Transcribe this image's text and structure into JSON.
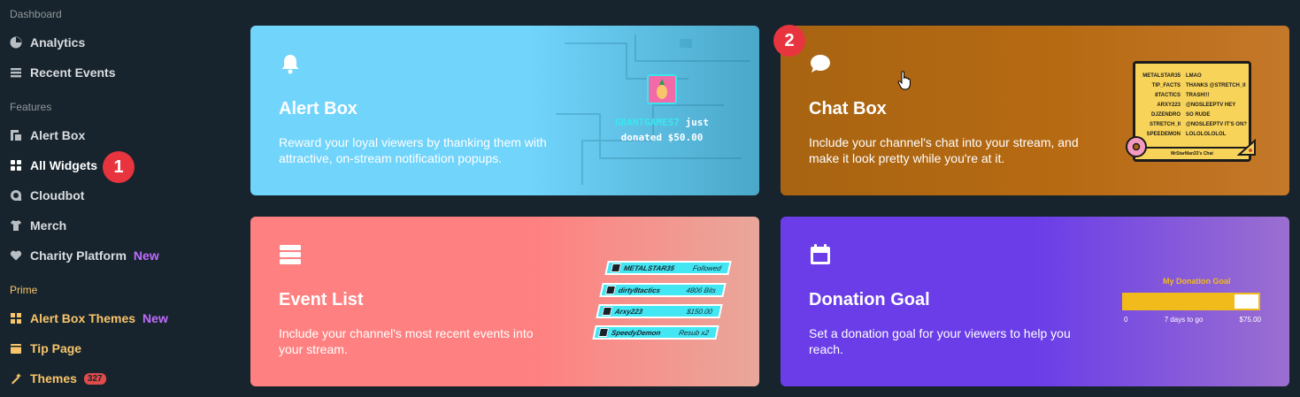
{
  "sidebar": {
    "sections": [
      {
        "label": "Dashboard"
      },
      {
        "label": "Features"
      },
      {
        "label": "Prime"
      }
    ],
    "items": [
      {
        "label": "Analytics",
        "icon": "analytics-icon"
      },
      {
        "label": "Recent Events",
        "icon": "list-icon"
      },
      {
        "label": "Alert Box",
        "icon": "alert-box-icon"
      },
      {
        "label": "All Widgets",
        "icon": "grid-icon"
      },
      {
        "label": "Cloudbot",
        "icon": "cloudbot-icon"
      },
      {
        "label": "Merch",
        "icon": "shirt-icon"
      },
      {
        "label": "Charity Platform",
        "icon": "heart-icon",
        "tag": "New"
      },
      {
        "label": "Alert Box Themes",
        "icon": "themes-grid-icon",
        "tag": "New"
      },
      {
        "label": "Tip Page",
        "icon": "tip-page-icon"
      },
      {
        "label": "Themes",
        "icon": "wand-icon",
        "count": "327"
      }
    ]
  },
  "badges": {
    "step1": "1",
    "step2": "2"
  },
  "cards": {
    "alert_box": {
      "title": "Alert Box",
      "desc": "Reward your loyal viewers by thanking them with attractive, on-stream notification popups.",
      "preview": {
        "name": "GRANTGAME57",
        "line1_suffix": " just",
        "line2": "donated $50.00"
      }
    },
    "chat_box": {
      "title": "Chat Box",
      "desc": "Include your channel's chat into your stream, and make it look pretty while you're at it.",
      "preview": {
        "rows": [
          {
            "user": "METALSTAR35",
            "msg": "LMAO"
          },
          {
            "user": "TIP_FACTS",
            "msg": "THANKS @STRETCH_II"
          },
          {
            "user": "8TACTICS",
            "msg": "TRASH!!!"
          },
          {
            "user": "ARXY223",
            "msg": "@NOSLEEPTV HEY"
          },
          {
            "user": "DJZENDRO",
            "msg": "SO RUDE"
          },
          {
            "user": "STRETCH_II",
            "msg": "@NOSLEEPTV IT'S ON?"
          },
          {
            "user": "SPEEDEMON",
            "msg": "LOLOLOLOLOL"
          }
        ],
        "footer": "MrStarMan33's Chat"
      }
    },
    "event_list": {
      "title": "Event List",
      "desc": "Include your channel's most recent events into your stream.",
      "preview": {
        "rows": [
          {
            "name": "METALSTAR35",
            "value": "Followed"
          },
          {
            "name": "dirty8tactics",
            "value": "4806 Bits"
          },
          {
            "name": "Arxy223",
            "value": "$150.00"
          },
          {
            "name": "SpeedyDemon",
            "value": "Resub x2"
          }
        ]
      }
    },
    "donation_goal": {
      "title": "Donation Goal",
      "desc": "Set a donation goal for your viewers to help you reach.",
      "preview": {
        "title": "My Donation Goal",
        "start": "0",
        "middle": "7 days to go",
        "end": "$75.00",
        "progress": 0.82
      }
    }
  }
}
